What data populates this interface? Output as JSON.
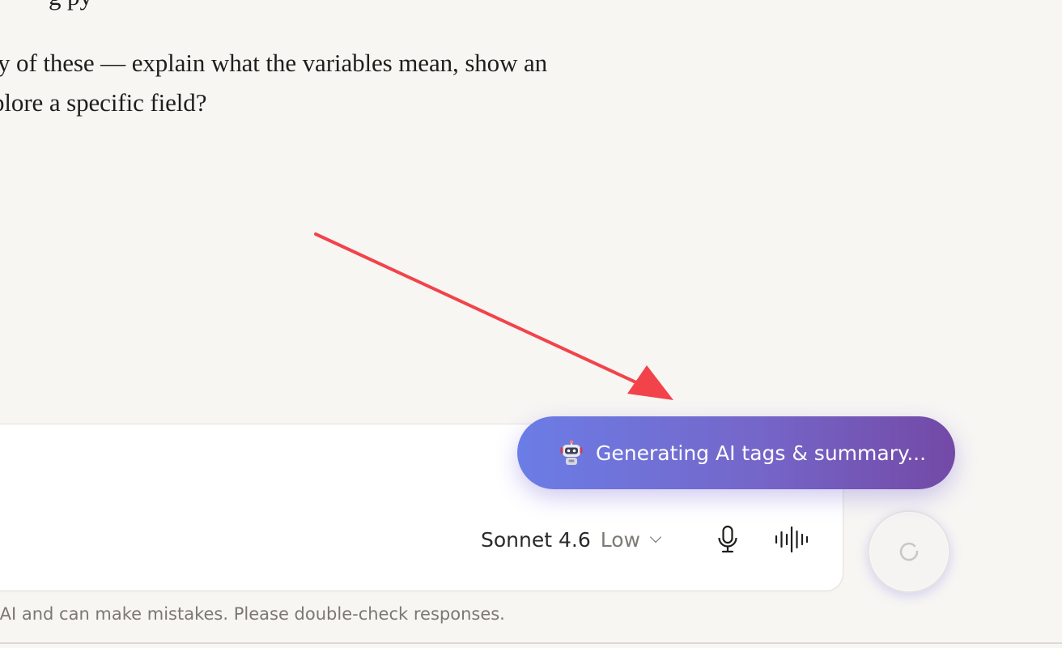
{
  "message": {
    "lines": [
      "g                           py",
      "y of these — explain what the variables mean, show an",
      "plore a specific field?"
    ]
  },
  "composer": {
    "model_name": "Sonnet 4.6",
    "effort": "Low",
    "icons": {
      "mic": "microphone-icon",
      "voice": "voice-waveform-icon",
      "send": "loading-spinner-icon",
      "dropdown": "chevron-down-icon"
    }
  },
  "toast": {
    "label": "Generating AI tags & summary...",
    "icon": "robot-icon",
    "gradient": [
      "#6b7de6",
      "#7349a6"
    ]
  },
  "annotation": {
    "arrow_color": "#f2434b"
  },
  "footer": {
    "disclaimer": "s AI and can make mistakes. Please double-check responses."
  },
  "colors": {
    "page_background": "#f7f6f3",
    "composer_background": "#ffffff"
  }
}
